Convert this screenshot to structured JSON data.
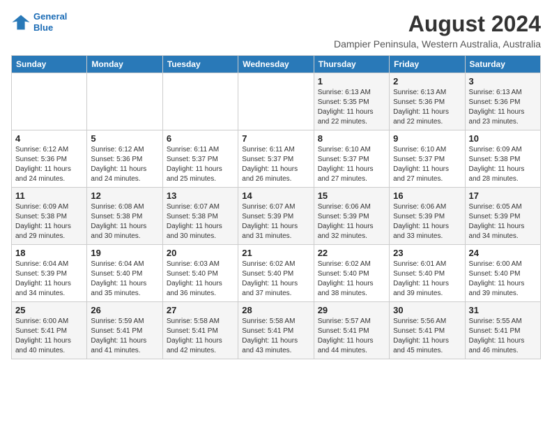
{
  "header": {
    "logo_line1": "General",
    "logo_line2": "Blue",
    "title": "August 2024",
    "subtitle": "Dampier Peninsula, Western Australia, Australia"
  },
  "weekdays": [
    "Sunday",
    "Monday",
    "Tuesday",
    "Wednesday",
    "Thursday",
    "Friday",
    "Saturday"
  ],
  "weeks": [
    [
      {
        "day": "",
        "info": ""
      },
      {
        "day": "",
        "info": ""
      },
      {
        "day": "",
        "info": ""
      },
      {
        "day": "",
        "info": ""
      },
      {
        "day": "1",
        "info": "Sunrise: 6:13 AM\nSunset: 5:35 PM\nDaylight: 11 hours\nand 22 minutes."
      },
      {
        "day": "2",
        "info": "Sunrise: 6:13 AM\nSunset: 5:36 PM\nDaylight: 11 hours\nand 22 minutes."
      },
      {
        "day": "3",
        "info": "Sunrise: 6:13 AM\nSunset: 5:36 PM\nDaylight: 11 hours\nand 23 minutes."
      }
    ],
    [
      {
        "day": "4",
        "info": "Sunrise: 6:12 AM\nSunset: 5:36 PM\nDaylight: 11 hours\nand 24 minutes."
      },
      {
        "day": "5",
        "info": "Sunrise: 6:12 AM\nSunset: 5:36 PM\nDaylight: 11 hours\nand 24 minutes."
      },
      {
        "day": "6",
        "info": "Sunrise: 6:11 AM\nSunset: 5:37 PM\nDaylight: 11 hours\nand 25 minutes."
      },
      {
        "day": "7",
        "info": "Sunrise: 6:11 AM\nSunset: 5:37 PM\nDaylight: 11 hours\nand 26 minutes."
      },
      {
        "day": "8",
        "info": "Sunrise: 6:10 AM\nSunset: 5:37 PM\nDaylight: 11 hours\nand 27 minutes."
      },
      {
        "day": "9",
        "info": "Sunrise: 6:10 AM\nSunset: 5:37 PM\nDaylight: 11 hours\nand 27 minutes."
      },
      {
        "day": "10",
        "info": "Sunrise: 6:09 AM\nSunset: 5:38 PM\nDaylight: 11 hours\nand 28 minutes."
      }
    ],
    [
      {
        "day": "11",
        "info": "Sunrise: 6:09 AM\nSunset: 5:38 PM\nDaylight: 11 hours\nand 29 minutes."
      },
      {
        "day": "12",
        "info": "Sunrise: 6:08 AM\nSunset: 5:38 PM\nDaylight: 11 hours\nand 30 minutes."
      },
      {
        "day": "13",
        "info": "Sunrise: 6:07 AM\nSunset: 5:38 PM\nDaylight: 11 hours\nand 30 minutes."
      },
      {
        "day": "14",
        "info": "Sunrise: 6:07 AM\nSunset: 5:39 PM\nDaylight: 11 hours\nand 31 minutes."
      },
      {
        "day": "15",
        "info": "Sunrise: 6:06 AM\nSunset: 5:39 PM\nDaylight: 11 hours\nand 32 minutes."
      },
      {
        "day": "16",
        "info": "Sunrise: 6:06 AM\nSunset: 5:39 PM\nDaylight: 11 hours\nand 33 minutes."
      },
      {
        "day": "17",
        "info": "Sunrise: 6:05 AM\nSunset: 5:39 PM\nDaylight: 11 hours\nand 34 minutes."
      }
    ],
    [
      {
        "day": "18",
        "info": "Sunrise: 6:04 AM\nSunset: 5:39 PM\nDaylight: 11 hours\nand 34 minutes."
      },
      {
        "day": "19",
        "info": "Sunrise: 6:04 AM\nSunset: 5:40 PM\nDaylight: 11 hours\nand 35 minutes."
      },
      {
        "day": "20",
        "info": "Sunrise: 6:03 AM\nSunset: 5:40 PM\nDaylight: 11 hours\nand 36 minutes."
      },
      {
        "day": "21",
        "info": "Sunrise: 6:02 AM\nSunset: 5:40 PM\nDaylight: 11 hours\nand 37 minutes."
      },
      {
        "day": "22",
        "info": "Sunrise: 6:02 AM\nSunset: 5:40 PM\nDaylight: 11 hours\nand 38 minutes."
      },
      {
        "day": "23",
        "info": "Sunrise: 6:01 AM\nSunset: 5:40 PM\nDaylight: 11 hours\nand 39 minutes."
      },
      {
        "day": "24",
        "info": "Sunrise: 6:00 AM\nSunset: 5:40 PM\nDaylight: 11 hours\nand 39 minutes."
      }
    ],
    [
      {
        "day": "25",
        "info": "Sunrise: 6:00 AM\nSunset: 5:41 PM\nDaylight: 11 hours\nand 40 minutes."
      },
      {
        "day": "26",
        "info": "Sunrise: 5:59 AM\nSunset: 5:41 PM\nDaylight: 11 hours\nand 41 minutes."
      },
      {
        "day": "27",
        "info": "Sunrise: 5:58 AM\nSunset: 5:41 PM\nDaylight: 11 hours\nand 42 minutes."
      },
      {
        "day": "28",
        "info": "Sunrise: 5:58 AM\nSunset: 5:41 PM\nDaylight: 11 hours\nand 43 minutes."
      },
      {
        "day": "29",
        "info": "Sunrise: 5:57 AM\nSunset: 5:41 PM\nDaylight: 11 hours\nand 44 minutes."
      },
      {
        "day": "30",
        "info": "Sunrise: 5:56 AM\nSunset: 5:41 PM\nDaylight: 11 hours\nand 45 minutes."
      },
      {
        "day": "31",
        "info": "Sunrise: 5:55 AM\nSunset: 5:41 PM\nDaylight: 11 hours\nand 46 minutes."
      }
    ]
  ]
}
